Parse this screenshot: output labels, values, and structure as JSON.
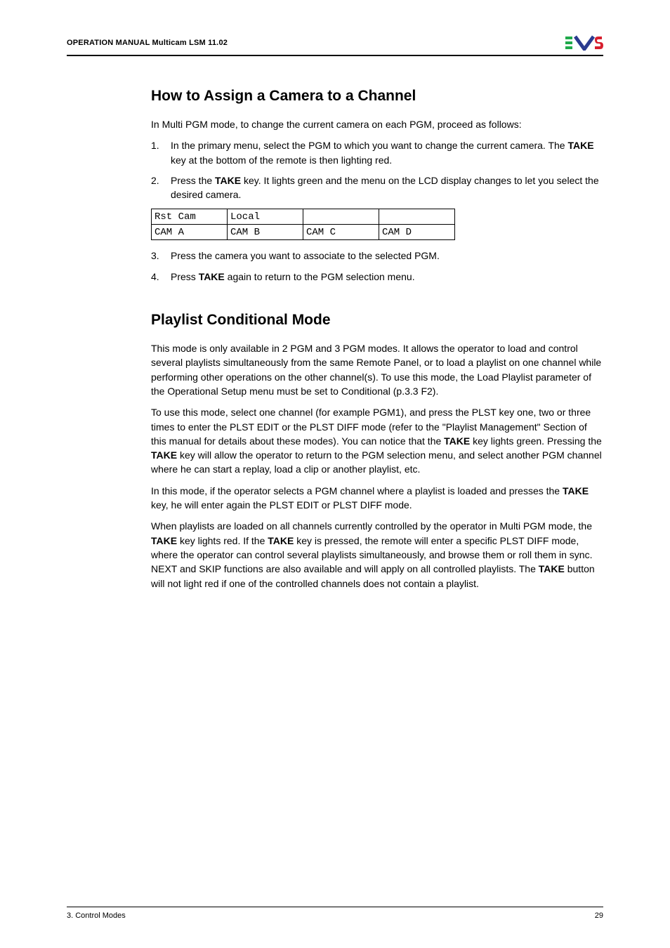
{
  "header": {
    "title": "OPERATION MANUAL Multicam LSM 11.02"
  },
  "section1": {
    "heading": "How to Assign a Camera to a Channel",
    "intro": "In Multi PGM mode, to change the current camera on each PGM, proceed as follows:",
    "step1_a": "In the primary menu, select the PGM to which you want to change the current camera. The ",
    "step1_b": "TAKE",
    "step1_c": " key at the bottom of the remote is then lighting red.",
    "step2_a": "Press the ",
    "step2_b": "TAKE",
    "step2_c": " key. It lights green and the menu on the LCD display changes to let you select the desired camera.",
    "grid": {
      "r1c1": "Rst Cam",
      "r1c2": "Local",
      "r1c3": "",
      "r1c4": "",
      "r2c1": "CAM A",
      "r2c2": "CAM B",
      "r2c3": "CAM C",
      "r2c4": "CAM D"
    },
    "step3": "Press the camera you want to associate to the selected PGM.",
    "step4_a": "Press ",
    "step4_b": "TAKE",
    "step4_c": " again to return to the PGM selection menu."
  },
  "section2": {
    "heading": "Playlist Conditional Mode",
    "p1": "This mode is only available in 2 PGM and 3 PGM modes. It allows the operator to load and control several playlists simultaneously from the same Remote Panel, or to load a playlist on one channel while performing other operations on the other channel(s). To use this mode, the Load Playlist parameter of the Operational Setup menu must be set to Conditional (p.3.3 F2).",
    "p2_a": "To use this mode, select one channel (for example PGM1), and press the PLST key one, two or three times to enter the PLST EDIT or the PLST DIFF mode (refer to the \"Playlist Management\" Section of this manual for details about these modes). You can notice that the ",
    "p2_b": "TAKE",
    "p2_c": " key lights green. Pressing the ",
    "p2_d": "TAKE",
    "p2_e": " key will allow the operator to return to the PGM selection menu, and select another PGM channel where he can start a replay, load a clip or another playlist, etc.",
    "p3_a": "In this mode, if the operator selects a PGM channel where a playlist is loaded and presses the ",
    "p3_b": "TAKE",
    "p3_c": " key, he will enter again the PLST EDIT or PLST DIFF mode.",
    "p4_a": "When playlists are loaded on all channels currently controlled by the operator in Multi PGM mode, the ",
    "p4_b": "TAKE",
    "p4_c": " key lights red. If the ",
    "p4_d": "TAKE",
    "p4_e": " key is pressed, the remote will enter a specific PLST DIFF mode, where the operator can control several playlists simultaneously, and browse them or roll them in sync. NEXT and SKIP functions are also available and will apply on all controlled playlists. The ",
    "p4_f": "TAKE",
    "p4_g": " button will not light red if one of the controlled channels does not contain a playlist."
  },
  "footer": {
    "left": "3. Control Modes",
    "right": "29"
  }
}
